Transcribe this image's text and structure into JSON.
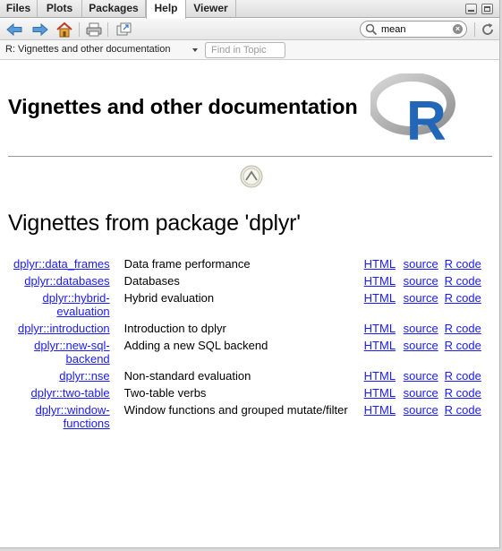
{
  "tabs": [
    {
      "label": "Files",
      "active": false
    },
    {
      "label": "Plots",
      "active": false
    },
    {
      "label": "Packages",
      "active": false
    },
    {
      "label": "Help",
      "active": true
    },
    {
      "label": "Viewer",
      "active": false
    }
  ],
  "toolbar": {
    "icons": [
      "back-arrow-icon",
      "forward-arrow-icon",
      "home-icon",
      "print-icon",
      "open-in-new-window-icon",
      "refresh-icon"
    ],
    "search_value": "mean",
    "clear_glyph": "×"
  },
  "subbar": {
    "breadcrumb": "R: Vignettes and other documentation",
    "find_placeholder": "Find in Topic"
  },
  "page": {
    "heading": "Vignettes and other documentation",
    "logo_letter": "R",
    "subheading": "Vignettes from package 'dplyr'"
  },
  "vignettes": [
    {
      "name": [
        "dplyr::data_frames"
      ],
      "title": "Data frame performance",
      "links": [
        "HTML",
        "source",
        "R code"
      ]
    },
    {
      "name": [
        "dplyr::databases"
      ],
      "title": "Databases",
      "links": [
        "HTML",
        "source",
        "R code"
      ]
    },
    {
      "name": [
        "dplyr::hybrid-",
        "evaluation"
      ],
      "title": "Hybrid evaluation",
      "links": [
        "HTML",
        "source",
        "R code"
      ]
    },
    {
      "name": [
        "dplyr::introduction"
      ],
      "title": "Introduction to dplyr",
      "links": [
        "HTML",
        "source",
        "R code"
      ]
    },
    {
      "name": [
        "dplyr::new-sql-",
        "backend"
      ],
      "title": "Adding a new SQL backend",
      "links": [
        "HTML",
        "source",
        "R code"
      ]
    },
    {
      "name": [
        "dplyr::nse"
      ],
      "title": "Non-standard evaluation",
      "links": [
        "HTML",
        "source",
        "R code"
      ]
    },
    {
      "name": [
        "dplyr::two-table"
      ],
      "title": "Two-table verbs",
      "links": [
        "HTML",
        "source",
        "R code"
      ]
    },
    {
      "name": [
        "dplyr::window-",
        "functions"
      ],
      "title": "Window functions and grouped mutate/filter",
      "links": [
        "HTML",
        "source",
        "R code"
      ]
    }
  ],
  "colors": {
    "link": "#1a1aff",
    "r_logo_blue": "#2266b8",
    "r_logo_gray": "#a8a8a8"
  }
}
